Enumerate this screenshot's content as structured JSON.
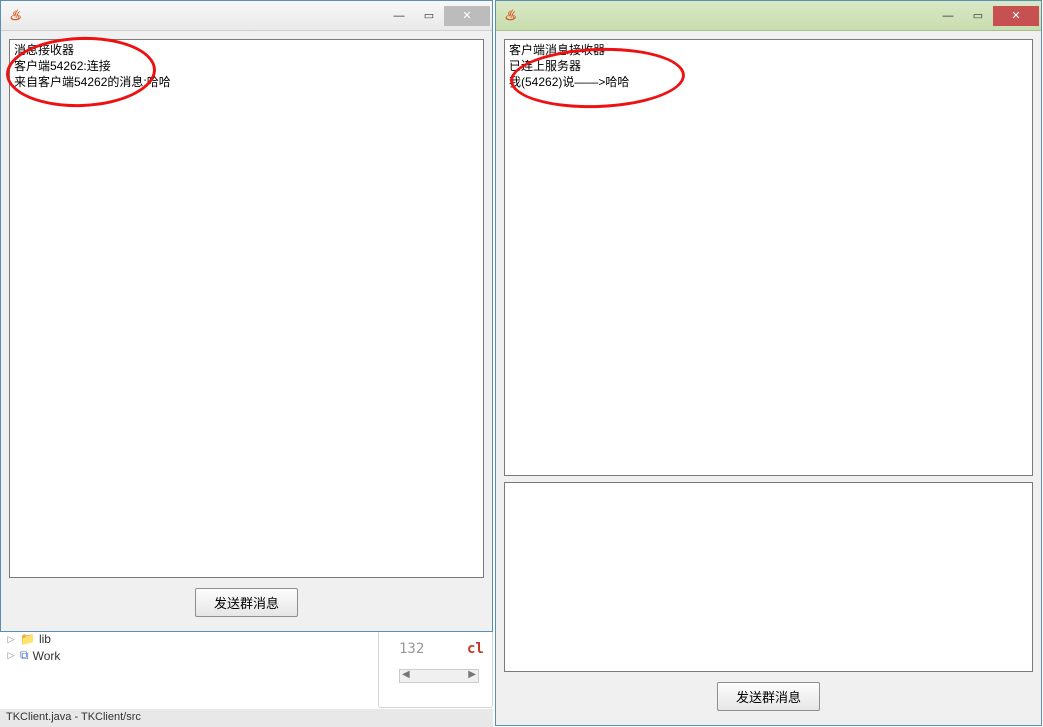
{
  "left_window": {
    "title": "",
    "messages": "消息接收器\n客户端54262:连接\n来自客户端54262的消息:哈哈",
    "send_button": "发送群消息"
  },
  "right_window": {
    "title": "",
    "messages": "客户端消息接收器\n已连上服务器\n我(54262)说——>哈哈",
    "input_text": "",
    "send_button": "发送群消息"
  },
  "win_controls": {
    "minimize": "—",
    "maximize": "▭",
    "close": "✕"
  },
  "ide": {
    "tree_item_lib": "lib",
    "tree_item_work": "Work",
    "line_number": "132",
    "code_frag": "cl",
    "status": "TKClient.java - TKClient/src"
  }
}
